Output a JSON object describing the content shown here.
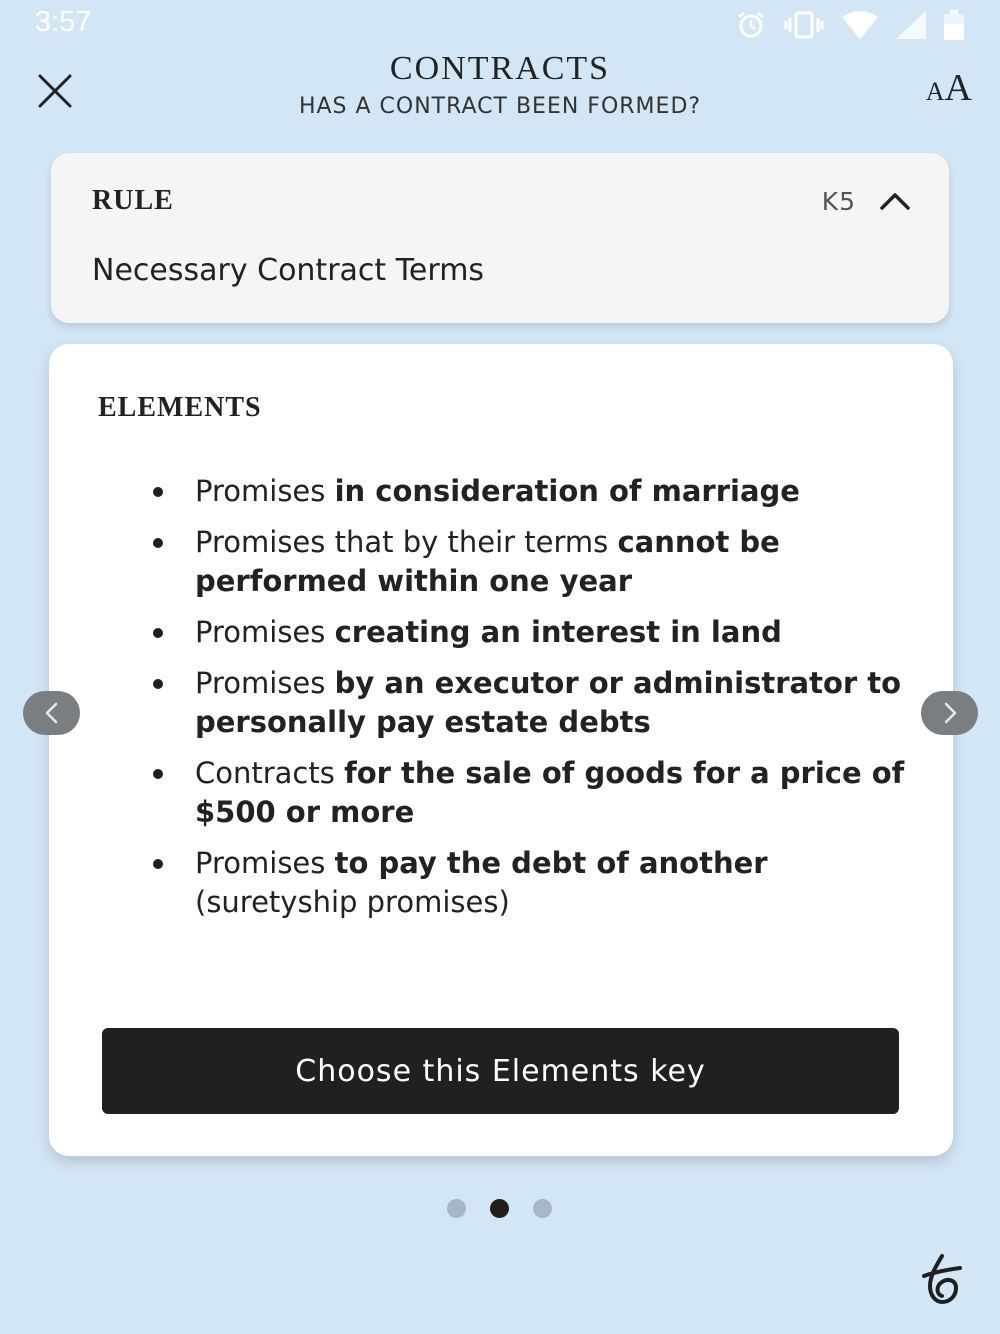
{
  "status_bar": {
    "time": "3:57",
    "icons": [
      "alarm-icon",
      "vibrate-icon",
      "wifi-icon",
      "signal-icon",
      "battery-icon"
    ]
  },
  "header": {
    "close_icon": "close-icon",
    "title": "CONTRACTS",
    "subtitle": "HAS A CONTRACT BEEN FORMED?",
    "font_size_small": "A",
    "font_size_large": "A"
  },
  "rule": {
    "label": "RULE",
    "code": "K5",
    "toggle_icon": "chevron-up-icon",
    "name": "Necessary Contract Terms"
  },
  "elements": {
    "label": "ELEMENTS",
    "items": [
      {
        "lead": "Promises ",
        "bold": "in consideration of marriage",
        "tail": ""
      },
      {
        "lead": "Promises that by their terms ",
        "bold": "cannot be performed within one year",
        "tail": ""
      },
      {
        "lead": "Promises ",
        "bold": "creating an interest in land",
        "tail": ""
      },
      {
        "lead": "Promises ",
        "bold": "by an executor or administrator to personally pay estate debts",
        "tail": ""
      },
      {
        "lead": "Contracts ",
        "bold": "for the sale of goods for a price of $500 or more",
        "tail": ""
      },
      {
        "lead": "Promises ",
        "bold": "to pay the debt of another",
        "tail": " (suretyship promises)"
      }
    ],
    "choose_button": "Choose this Elements key"
  },
  "navigation": {
    "prev_icon": "chevron-left-icon",
    "next_icon": "chevron-right-icon",
    "pages": 3,
    "active_page": 2
  },
  "colors": {
    "background": "#d3e6f6",
    "card": "#ffffff",
    "button": "#202020",
    "dot_inactive": "#a6b7c5",
    "dot_active": "#1f1f1f"
  },
  "brand_icon": "brand-logo-icon"
}
